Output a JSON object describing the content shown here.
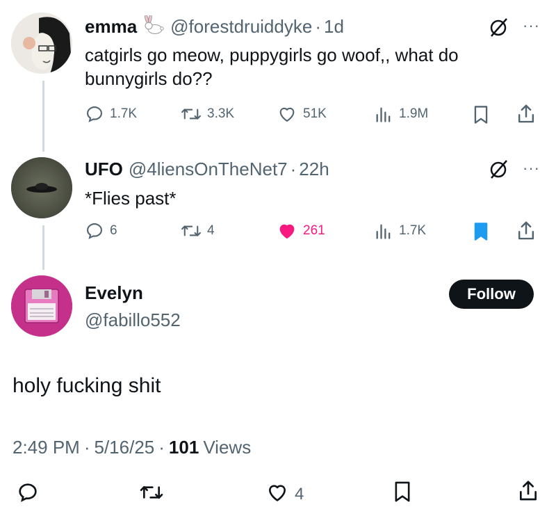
{
  "tweet1": {
    "name": "emma",
    "handle": "@forestdruiddyke",
    "sep": "·",
    "time": "1d",
    "text_line1": "catgirls go meow, puppygirls go woof,, what do",
    "text_line2": "bunnygirls do??",
    "more": "···",
    "metrics": {
      "replies": "1.7K",
      "reposts": "3.3K",
      "likes": "51K",
      "views": "1.9M"
    }
  },
  "tweet2": {
    "name": "UFO",
    "handle": "@4liensOnTheNet7",
    "sep": "·",
    "time": "22h",
    "text": "*Flies past*",
    "more": "···",
    "metrics": {
      "replies": "6",
      "reposts": "4",
      "likes": "261",
      "views": "1.7K"
    }
  },
  "main": {
    "name": "Evelyn",
    "handle": "@fabillo552",
    "follow_label": "Follow",
    "text": "holy fucking shit",
    "time": "2:49 PM",
    "sep1": "·",
    "date": "5/16/25",
    "sep2": "·",
    "views_count": "101",
    "views_label": "Views",
    "likes": "4"
  },
  "colors": {
    "text": "#0f1419",
    "muted": "#536471",
    "like_active": "#f91880",
    "bookmark_active": "#1d9bf0",
    "thread_line": "#cfd9de"
  },
  "icons": [
    "bunny-emoji-icon",
    "no-sign-icon",
    "reply-icon",
    "repost-icon",
    "like-icon",
    "views-icon",
    "bookmark-icon",
    "share-icon",
    "floppy-disk-avatar",
    "ufo-avatar"
  ]
}
